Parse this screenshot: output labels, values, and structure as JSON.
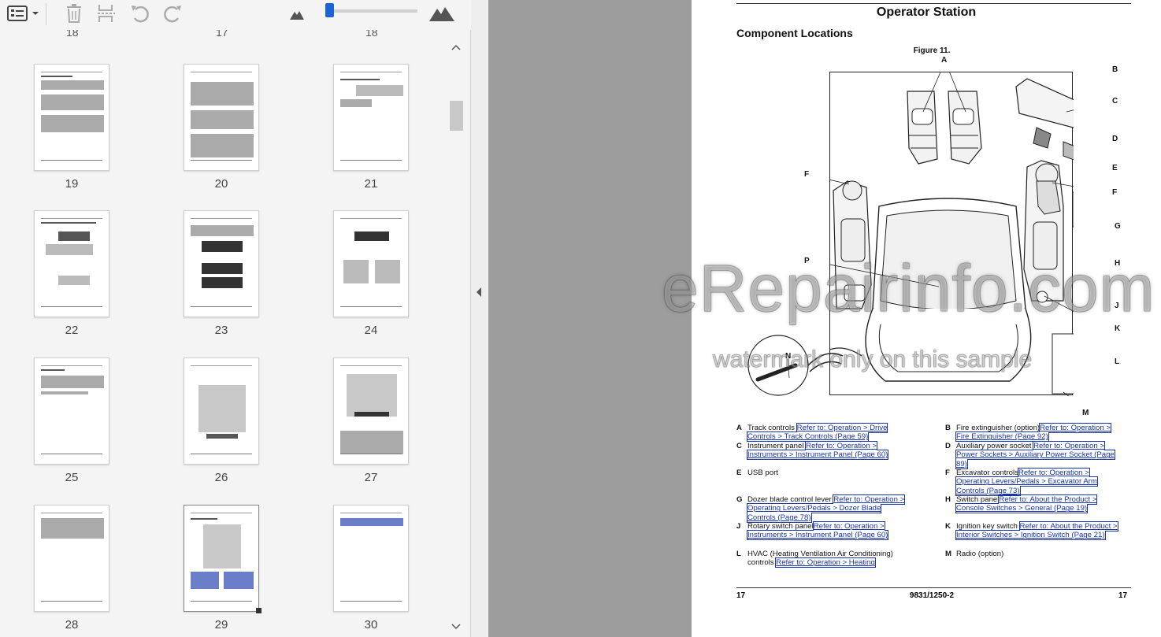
{
  "toolbar": {
    "icons": [
      "panel-options-icon",
      "delete-icon",
      "extract-icon",
      "rotate-left-icon",
      "rotate-right-icon",
      "zoom-out-icon",
      "zoom-in-icon"
    ],
    "zoom_level": 0.05
  },
  "thumbnails": {
    "top_partial_labels": [
      "18",
      "17",
      "18"
    ],
    "pages": [
      {
        "label": "19"
      },
      {
        "label": "20"
      },
      {
        "label": "21"
      },
      {
        "label": "22"
      },
      {
        "label": "23"
      },
      {
        "label": "24"
      },
      {
        "label": "25"
      },
      {
        "label": "26"
      },
      {
        "label": "27"
      },
      {
        "label": "28"
      },
      {
        "label": "29"
      },
      {
        "label": "30"
      }
    ]
  },
  "document": {
    "title": "Operator Station",
    "subtitle": "Component Locations",
    "figure_label": "Figure 11.",
    "callouts": [
      "A",
      "B",
      "C",
      "D",
      "E",
      "F",
      "F",
      "G",
      "H",
      "J",
      "K",
      "L",
      "M",
      "N",
      "P"
    ],
    "legend": [
      {
        "key": "A",
        "text": "Track controls ",
        "ref": "Refer to: Operation > Drive Controls > Track Controls (Page 59)"
      },
      {
        "key": "B",
        "text": "Fire extinguisher (option)",
        "ref": "Refer to: Operation > Fire Extinguisher (Page 92)"
      },
      {
        "key": "C",
        "text": "Instrument panel ",
        "ref": "Refer to: Operation > Instruments > Instrument Panel (Page 60)"
      },
      {
        "key": "D",
        "text": "Auxiliary power socket ",
        "ref": "Refer to: Operation > Power Sockets > Auxiliary Power Socket (Page 89)"
      },
      {
        "key": "E",
        "text": "USB port",
        "ref": ""
      },
      {
        "key": "F",
        "text": "Excavator controls",
        "ref": "Refer to: Operation > Operating Levers/Pedals > Excavator Arm Controls (Page 73)"
      },
      {
        "key": "G",
        "text": "Dozer blade control lever ",
        "ref": "Refer to: Operation > Operating Levers/Pedals > Dozer Blade Controls (Page 78)"
      },
      {
        "key": "H",
        "text": "Switch panel",
        "ref": "Refer to: About the Product > Console Switches > General (Page 19)"
      },
      {
        "key": "J",
        "text": "Rotary switch panel",
        "ref": "Refer to: Operation > Instruments > Instrument Panel (Page 60)"
      },
      {
        "key": "K",
        "text": "Ignition key switch ",
        "ref": "Refer to: About the Product > Interior Switches > Ignition Switch (Page 21)"
      },
      {
        "key": "L",
        "text": "HVAC (Heating Ventilation Air Conditioning) controls ",
        "ref": "Refer to: Operation > Heating"
      },
      {
        "key": "M",
        "text": "Radio (option)",
        "ref": ""
      }
    ],
    "footer": {
      "left": "17",
      "center": "9831/1250-2",
      "right": "17"
    }
  },
  "watermark": {
    "main": "eRepairinfo.com",
    "sub": "watermark only on this sample"
  }
}
